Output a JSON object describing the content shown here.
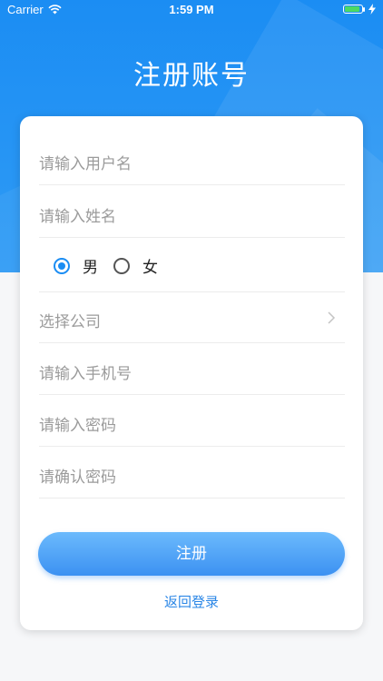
{
  "status_bar": {
    "carrier": "Carrier",
    "time": "1:59 PM",
    "battery_level": 0.9,
    "icons": [
      "wifi-icon",
      "battery-icon",
      "charging-bolt-icon"
    ]
  },
  "header": {
    "title": "注册账号"
  },
  "form": {
    "username_placeholder": "请输入用户名",
    "name_placeholder": "请输入姓名",
    "gender": {
      "options": [
        {
          "label": "男",
          "selected": true
        },
        {
          "label": "女",
          "selected": false
        }
      ]
    },
    "company_placeholder": "选择公司",
    "phone_placeholder": "请输入手机号",
    "password_placeholder": "请输入密码",
    "confirm_password_placeholder": "请确认密码",
    "register_label": "注册",
    "back_login_label": "返回登录"
  },
  "colors": {
    "primary": "#1b8df3",
    "button_top": "#6cbafc",
    "button_bottom": "#3c91f2",
    "link": "#2a86e6",
    "placeholder": "#9b9b9b"
  }
}
